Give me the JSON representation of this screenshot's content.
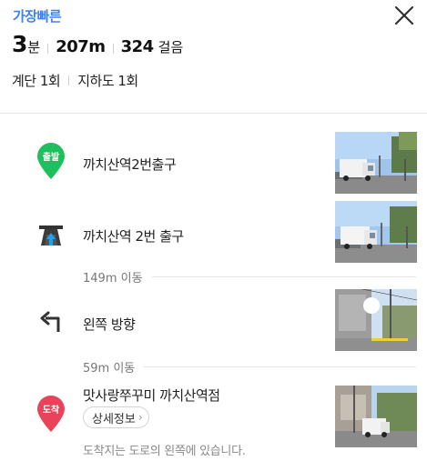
{
  "header": {
    "route_type": "가장빠른",
    "time_value": "3",
    "time_unit": "분",
    "distance": "207m",
    "steps_value": "324",
    "steps_unit": "걸음",
    "stairs": "계단 1회",
    "underpass": "지하도 1회",
    "close_icon": "close-icon"
  },
  "steps": [
    {
      "icon": "start-pin-icon",
      "badge": "출발",
      "label": "까치산역2번출구"
    },
    {
      "icon": "subway-exit-icon",
      "label": "까치산역 2번 출구"
    },
    {
      "distance": "149m 이동"
    },
    {
      "icon": "turn-left-icon",
      "label": "왼쪽 방향"
    },
    {
      "distance": "59m 이동"
    },
    {
      "icon": "arrival-pin-icon",
      "badge": "도착",
      "label": "맛사랑쭈꾸미 까치산역점",
      "detail_button": "상세정보",
      "note": "도착지는 도로의 왼쪽에 있습니다."
    }
  ],
  "colors": {
    "accent_blue": "#3b82f6",
    "start_green": "#1fbf5f",
    "arrive_red": "#e8435a"
  }
}
